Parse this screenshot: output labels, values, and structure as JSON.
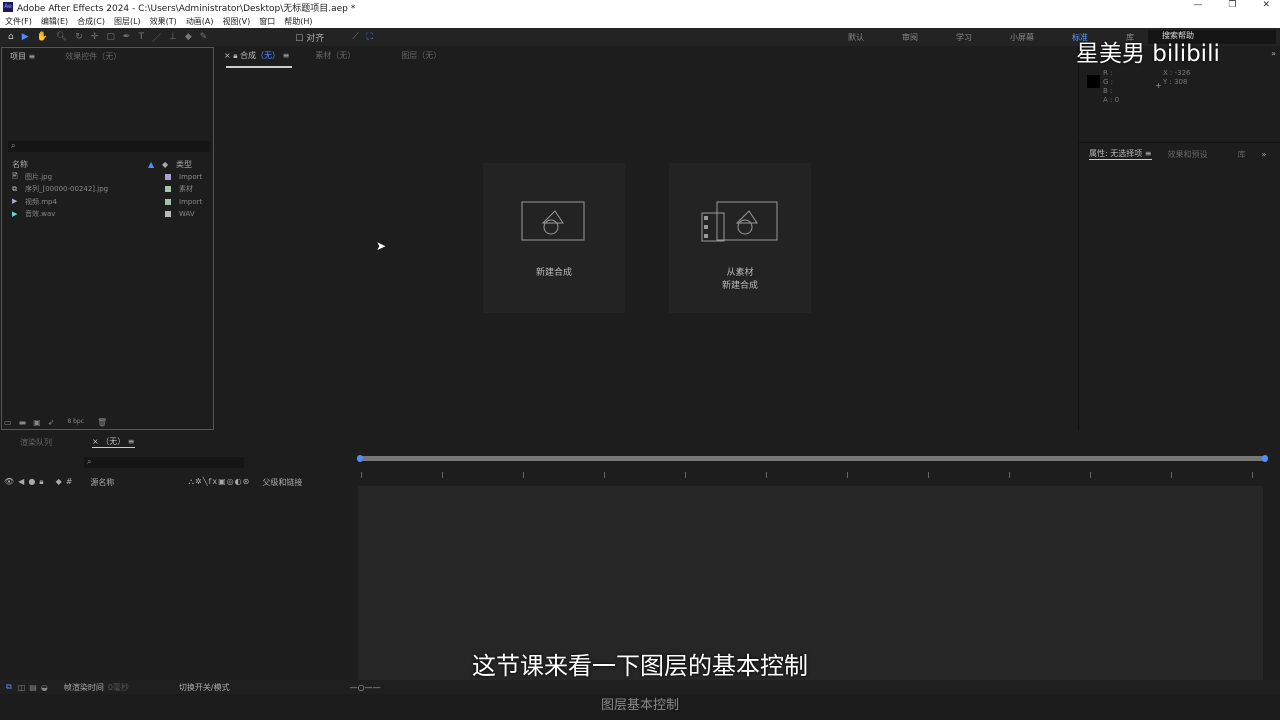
{
  "window": {
    "title": "Adobe After Effects 2024 - C:\\Users\\Administrator\\Desktop\\无标题项目.aep *",
    "logo": "Ae",
    "controls": [
      "—",
      "❐",
      "✕"
    ]
  },
  "menu": [
    "文件(F)",
    "编辑(E)",
    "合成(C)",
    "图层(L)",
    "效果(T)",
    "动画(A)",
    "视图(V)",
    "窗口",
    "帮助(H)"
  ],
  "toolbar": {
    "snap_label": "对齐"
  },
  "workspaces": [
    "默认",
    "审阅",
    "学习",
    "小屏幕",
    "标准",
    "库"
  ],
  "help_search": {
    "placeholder": "搜索帮助"
  },
  "project": {
    "tab": "项目",
    "effects_tab": "效果控件（无）",
    "col_name": "名称",
    "col_type": "类型",
    "bpc": "8 bpc",
    "items": [
      {
        "name": "图片.jpg",
        "type": "Import",
        "color": "#a9a0d0"
      },
      {
        "name": "序列_[00000-00242].jpg",
        "type": "素材",
        "color": "#a0c8a8"
      },
      {
        "name": "视频.mp4",
        "type": "Import",
        "color": "#a8c0b0"
      },
      {
        "name": "音效.wav",
        "type": "WAV",
        "color": "#bbbbbb"
      }
    ]
  },
  "comp": {
    "tab": "合成",
    "tab_sub": "（无）",
    "footage_tab": "素材（无）",
    "layer_tab": "图层（无）",
    "new_comp": "新建合成",
    "from_footage_line1": "从素材",
    "from_footage_line2": "新建合成"
  },
  "info": {
    "r": "R :",
    "g": "G :",
    "b": "B :",
    "a": "A : 0",
    "x": "X : -326",
    "y": "Y : 308"
  },
  "properties": {
    "tab": "属性: 无选择项",
    "effects_tab": "效果和预设",
    "library_tab": "库"
  },
  "timeline": {
    "render_tab": "渲染队列",
    "comp_tab": "（无）",
    "col_source": "源名称",
    "col_parent": "父级和链接"
  },
  "bottom": {
    "frame_render": "帧渲染时间",
    "frame_ms": "0毫秒",
    "toggle": "切换开关/模式"
  },
  "overlay": {
    "subtitle": "这节课来看一下图层的基本控制",
    "footer": "图层基本控制",
    "watermark": "星美男 bilibili"
  }
}
